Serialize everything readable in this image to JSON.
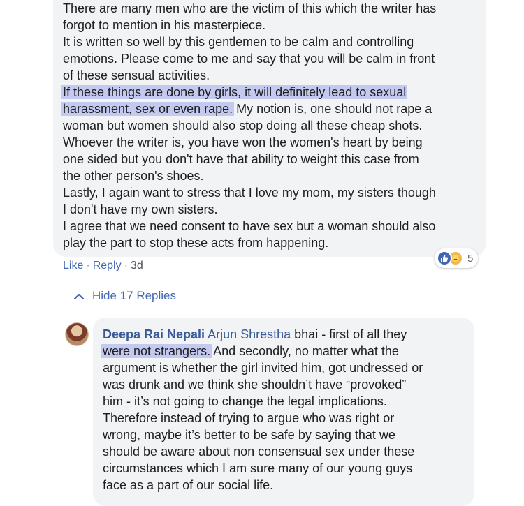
{
  "comment": {
    "lines": [
      "There are many men who are the victim of this which the writer has",
      "forgot to mention in his masterpiece.",
      "It is written so well by this gentlemen to be calm and controlling",
      "emotions. Please come to me and say that you will be calm in front",
      "of these sensual activities."
    ],
    "highlight_line1": "If these things are done by girls, it will definitely lead to sexual",
    "highlight_line2": "harassment, sex or even rape.",
    "line7_rest": " My notion is, one should not rape a",
    "lines_after": [
      "woman but women should also stop doing all these cheap shots.",
      "Whoever the writer is, you have won the women's heart by being",
      "one sided but you don't have that ability to weight this case from",
      "the other person's shoes.",
      "Lastly, I again want to stress that I love my mom, my sisters though",
      "I don't have my own sisters.",
      "I agree that we need consent to have sex but a woman should also",
      "play the part to stop these acts from happening."
    ],
    "reaction_count": "5",
    "reaction_icons": [
      "like-icon",
      "love-icon"
    ]
  },
  "actions": {
    "like": "Like",
    "separator": "·",
    "reply": "Reply",
    "time": "3d"
  },
  "replies_toggle": {
    "label": "Hide 17 Replies",
    "icon": "chevron-up-icon"
  },
  "reply": {
    "author": "Deepa Rai Nepali",
    "mention": "Arjun Shrestha",
    "line1_rest": " bhai - first of all they",
    "highlight": "were not strangers.",
    "line2_rest": " And secondly, no matter what the",
    "lines_after": [
      "argument is whether the girl invited him, got undressed or",
      "was drunk and we think she shouldn’t have “provoked”",
      "him - it’s not going to change the legal implications.",
      "Therefore instead of trying to argue who was right or",
      "wrong, maybe it’s better to be safe by saying that we",
      "should be aware about non consensual sex under these",
      "circumstances which I am sure many of our young guys",
      "face as a part of our social life."
    ]
  },
  "colors": {
    "link": "#4267b2",
    "author": "#385898",
    "highlight": "#c4c9f0",
    "bubble": "#f2f3f5"
  }
}
